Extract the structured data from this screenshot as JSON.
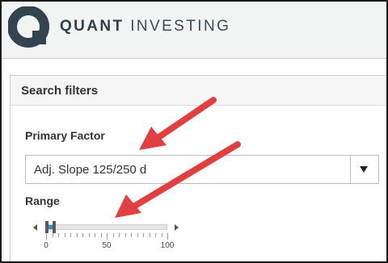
{
  "header": {
    "brand_bold": "QUANT",
    "brand_light": " INVESTING",
    "logo_icon": "quant-logo-icon"
  },
  "panel": {
    "title": "Search filters",
    "primary_factor_label": "Primary Factor",
    "primary_factor_value": "Adj. Slope 125/250 d",
    "range_label": "Range",
    "range": {
      "min": 0,
      "max": 100,
      "low_value": 0,
      "high_value": 6,
      "tick_labels": [
        "0",
        "50",
        "100"
      ]
    }
  },
  "colors": {
    "accent": "#2b8fd6",
    "annotation_arrow": "#e04040",
    "brand_text": "#2f3f4a"
  }
}
